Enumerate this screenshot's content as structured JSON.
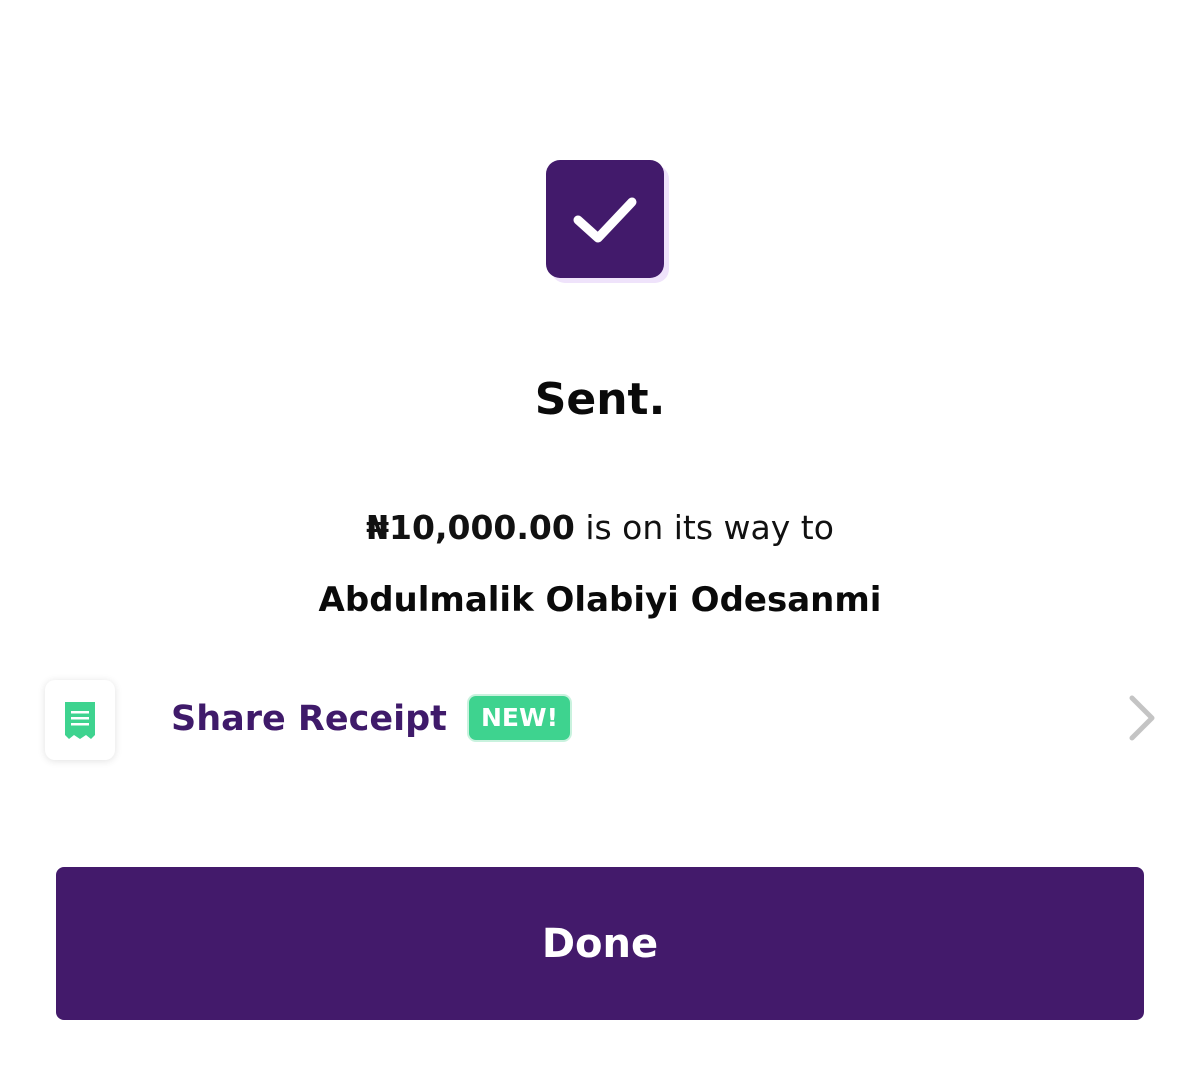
{
  "status": {
    "title": "Sent.",
    "icon": "check-icon"
  },
  "transfer": {
    "amount": "₦10,000.00",
    "message_suffix": " is on its way to",
    "recipient": "Abdulmalik Olabiyi Odesanmi"
  },
  "share_receipt": {
    "label": "Share Receipt",
    "badge": "NEW!",
    "icon": "receipt-icon",
    "chevron_icon": "chevron-right-icon"
  },
  "actions": {
    "done_label": "Done"
  },
  "colors": {
    "brand_purple": "#421a6b",
    "badge_green": "#3ed38f",
    "chevron_gray": "#c4c4c4"
  }
}
